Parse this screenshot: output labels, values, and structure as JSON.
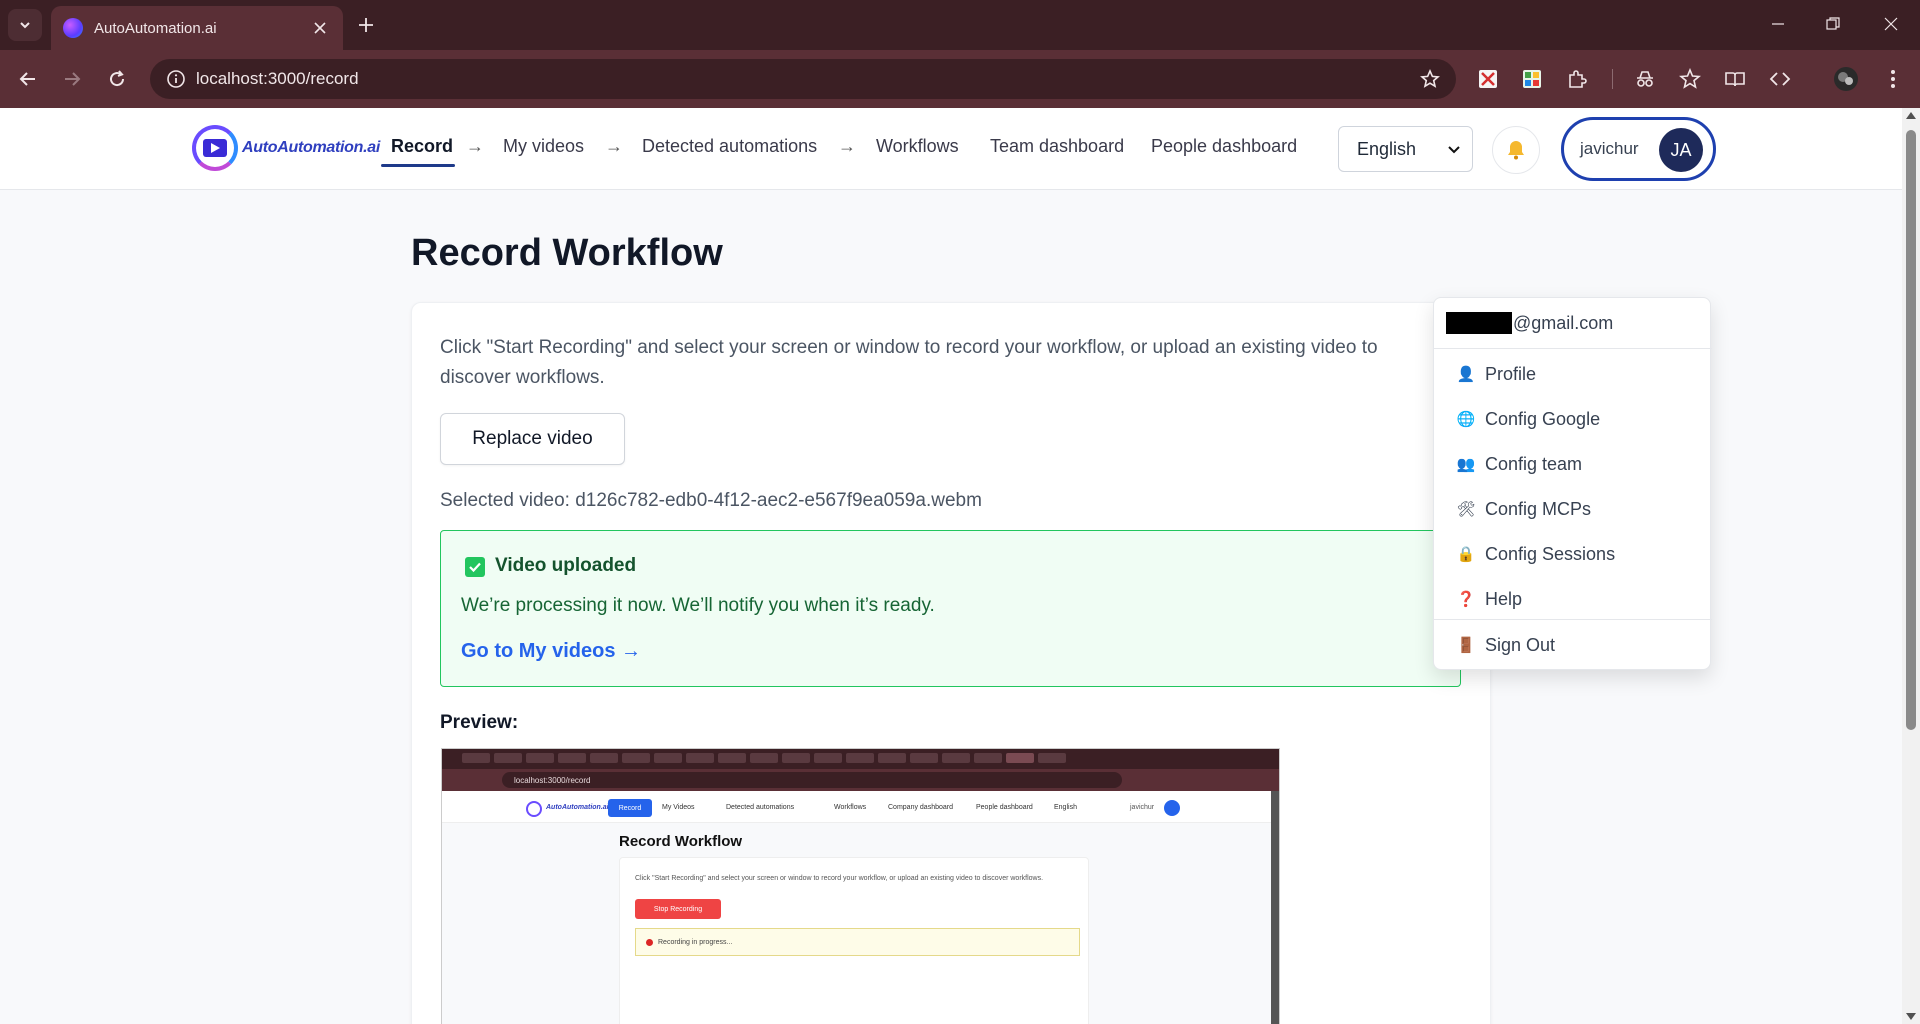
{
  "browser": {
    "tab_title": "AutoAutomation.ai",
    "url": "localhost:3000/record"
  },
  "nav": {
    "logo_text": "AutoAutomation.ai",
    "links": {
      "record": "Record",
      "my_videos": "My videos",
      "detected_automations": "Detected automations",
      "workflows": "Workflows",
      "team_dashboard": "Team dashboard",
      "people_dashboard": "People dashboard"
    },
    "arrow": "→",
    "language": "English",
    "bell_icon": "bell-icon",
    "user_name": "javichur",
    "user_initials": "JA"
  },
  "page": {
    "title": "Record Workflow",
    "intro": "Click \"Start Recording\" and select your screen or window to record your workflow, or upload an existing video to discover workflows.",
    "replace_button": "Replace video",
    "selected_video": "Selected video: d126c782-edb0-4f12-aec2-e567f9ea059a.webm",
    "success": {
      "title": "Video uploaded",
      "message": "We’re processing it now. We’ll notify you when it’s ready.",
      "link": "Go to My videos →"
    },
    "preview_label": "Preview:"
  },
  "preview_shot": {
    "url": "localhost:3000/record",
    "logo_text": "AutoAutomation.ai",
    "record": "Record",
    "my_videos": "My Videos",
    "detected": "Detected automations",
    "workflows": "Workflows",
    "company_dashboard": "Company dashboard",
    "people_dashboard": "People dashboard",
    "language": "English",
    "user": "javichur",
    "title": "Record Workflow",
    "intro": "Click \"Start Recording\" and select your screen or window to record your workflow, or upload an existing video to discover workflows.",
    "stop": "Stop Recording",
    "progress": "Recording in progress..."
  },
  "dropdown": {
    "email_suffix": "@gmail.com",
    "items": [
      {
        "label": "Profile",
        "icon": "👤"
      },
      {
        "label": "Config Google",
        "icon": "🌐"
      },
      {
        "label": "Config team",
        "icon": "👥"
      },
      {
        "label": "Config MCPs",
        "icon": "🛠"
      },
      {
        "label": "Config Sessions",
        "icon": "🔒"
      },
      {
        "label": "Help",
        "icon": "❓"
      },
      {
        "label": "Sign Out",
        "icon": "🚪"
      }
    ]
  },
  "colors": {
    "chrome_dark": "#3b1f24",
    "chrome_mid": "#5a2f36",
    "accent": "#1e40af",
    "success_bg": "#f0fdf4",
    "success_border": "#22c55e",
    "link": "#2563eb"
  }
}
